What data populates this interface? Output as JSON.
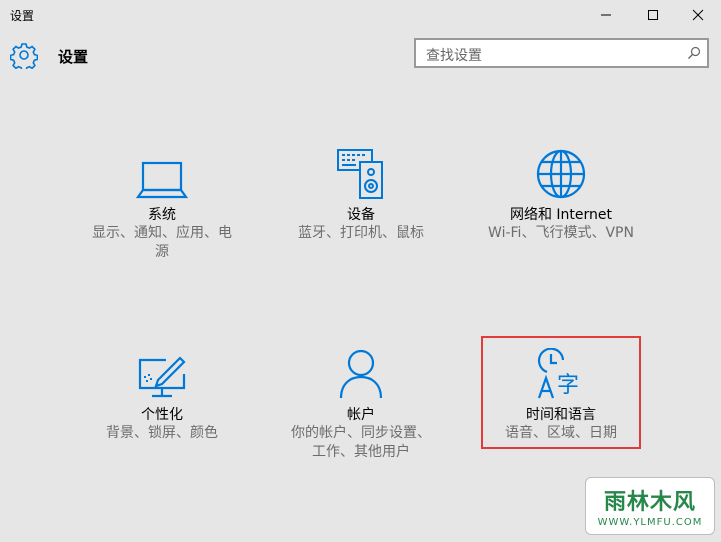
{
  "window": {
    "title": "设置",
    "controls": {
      "minimize": "minimize-icon",
      "maximize": "maximize-icon",
      "close": "close-icon"
    }
  },
  "header": {
    "icon": "gear-icon",
    "title": "设置",
    "search_placeholder": "查找设置",
    "search_icon": "search-icon"
  },
  "accent": "#0078d7",
  "highlight_color": "#e23b3b",
  "tiles": [
    {
      "name": "系统",
      "desc": [
        "显示、通知、应用、电",
        "源"
      ],
      "icon": "laptop-icon"
    },
    {
      "name": "设备",
      "desc": [
        "蓝牙、打印机、鼠标"
      ],
      "icon": "keyboard-speaker-icon"
    },
    {
      "name": "网络和 Internet",
      "desc": [
        "Wi-Fi、飞行模式、VPN"
      ],
      "icon": "globe-icon"
    },
    {
      "name": "个性化",
      "desc": [
        "背景、锁屏、颜色"
      ],
      "icon": "monitor-pen-icon"
    },
    {
      "name": "帐户",
      "desc": [
        "你的帐户、同步设置、",
        "工作、其他用户"
      ],
      "icon": "person-icon"
    },
    {
      "name": "时间和语言",
      "desc": [
        "语音、区域、日期"
      ],
      "icon": "clock-language-icon"
    }
  ],
  "watermark": {
    "main": "雨林木风",
    "sub": "WWW.YLMFU.COM"
  }
}
